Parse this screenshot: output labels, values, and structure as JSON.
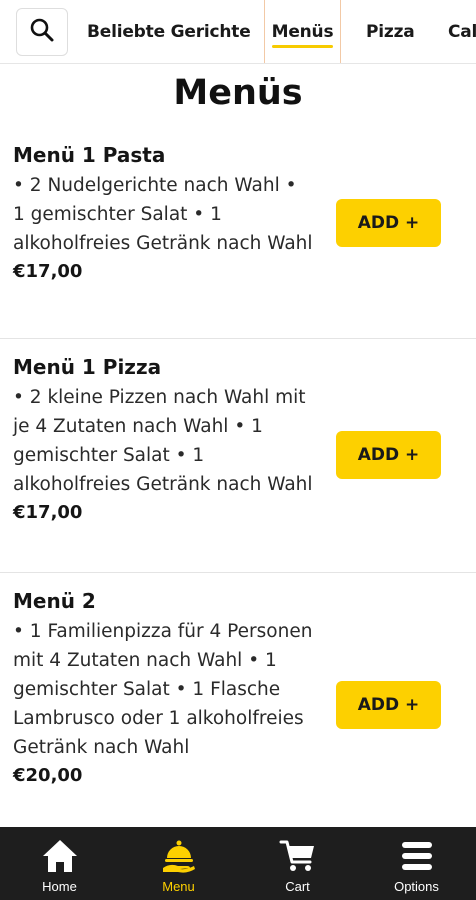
{
  "topbar": {
    "search_icon": "search-icon",
    "tabs": [
      {
        "label": "Beliebte Gerichte",
        "active": false
      },
      {
        "label": "Menüs",
        "active": true
      },
      {
        "label": "Pizza",
        "active": false
      },
      {
        "label": "Cal",
        "active": false
      }
    ]
  },
  "section": {
    "title": "Menüs"
  },
  "items": [
    {
      "name": "Menü 1 Pasta",
      "description": "• 2 Nudelgerichte nach Wahl • 1 gemischter Salat • 1 alkoholfreies Getränk nach Wahl",
      "price": "€17,00",
      "add_label": "ADD +"
    },
    {
      "name": "Menü 1 Pizza",
      "description": "• 2 kleine Pizzen nach Wahl mit je 4 Zutaten nach Wahl • 1 gemischter Salat • 1 alkoholfreies Getränk nach Wahl",
      "price": "€17,00",
      "add_label": "ADD +"
    },
    {
      "name": "Menü 2",
      "description": "• 1 Familienpizza für 4 Personen mit 4 Zutaten nach Wahl • 1 gemischter Salat • 1 Flasche Lambrusco oder 1 alkoholfreies Getränk nach Wahl",
      "price": "€20,00",
      "add_label": "ADD +"
    }
  ],
  "bottom_nav": [
    {
      "label": "Home",
      "icon": "home-icon",
      "active": false
    },
    {
      "label": "Menu",
      "icon": "menu-cloche-icon",
      "active": true
    },
    {
      "label": "Cart",
      "icon": "cart-icon",
      "active": false
    },
    {
      "label": "Options",
      "icon": "hamburger-icon",
      "active": false
    }
  ],
  "colors": {
    "accent": "#fdd000",
    "nav_background": "#1e1e1e",
    "active_tab_border": "#f2c9a6"
  }
}
